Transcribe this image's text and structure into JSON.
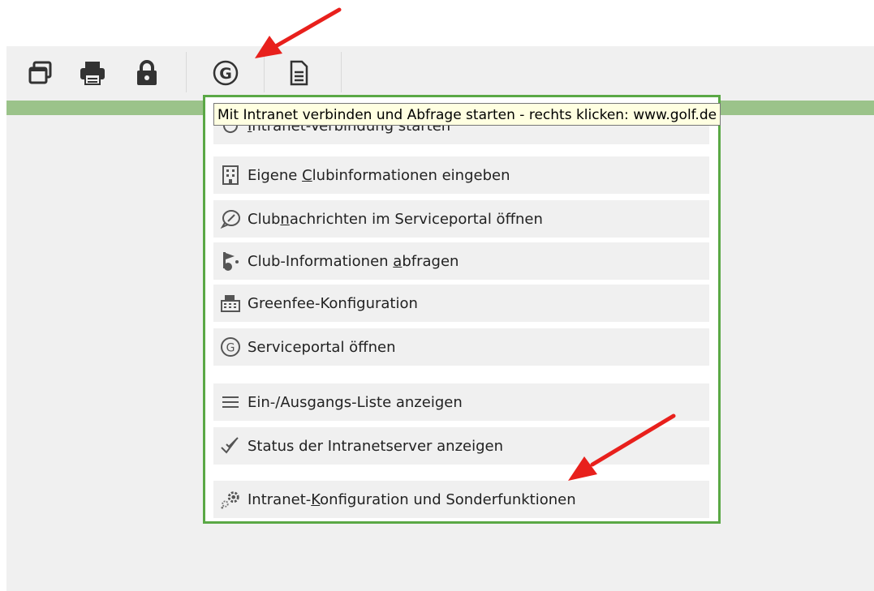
{
  "tooltip": {
    "text": "Mit Intranet verbinden und Abfrage starten - rechts klicken: www.golf.de"
  },
  "toolbar": {
    "buttons": [
      {
        "icon": "windows-icon"
      },
      {
        "icon": "printer-icon"
      },
      {
        "icon": "lock-icon"
      },
      {
        "icon": "golf-g-icon"
      },
      {
        "icon": "document-icon"
      }
    ]
  },
  "menu": {
    "item0": {
      "pre": "",
      "ul": "I",
      "post": "ntranet-Verbindung starten",
      "icon": "refresh-icon"
    },
    "item1": {
      "pre": "Eigene ",
      "ul": "C",
      "post": "lubinformationen eingeben",
      "icon": "building-icon"
    },
    "item2": {
      "pre": "Club",
      "ul": "n",
      "post": "achrichten im Serviceportal öffnen",
      "icon": "message-icon"
    },
    "item3": {
      "pre": "Club-Informationen ",
      "ul": "a",
      "post": "bfragen",
      "icon": "golf-flag-icon"
    },
    "item4": {
      "pre": "Greenfee-Konfiguration",
      "ul": "",
      "post": "",
      "icon": "cash-register-icon"
    },
    "item5": {
      "pre": "Serviceportal öffnen",
      "ul": "",
      "post": "",
      "icon": "golf-g-icon"
    },
    "item6": {
      "pre": "Ein-/Ausgangs-Liste anzeigen",
      "ul": "",
      "post": "",
      "icon": "list-icon"
    },
    "item7": {
      "pre": "Status der Intranetserver anzeigen",
      "ul": "",
      "post": "",
      "icon": "double-check-icon"
    },
    "item8": {
      "pre": "Intranet-",
      "ul": "K",
      "post": "onfiguration und Sonderfunktionen",
      "icon": "gears-icon"
    }
  },
  "colors": {
    "menu_border": "#5aa845",
    "green_bar": "#9bc38a",
    "arrow": "#e8201c",
    "tooltip_bg": "#ffffe1"
  }
}
